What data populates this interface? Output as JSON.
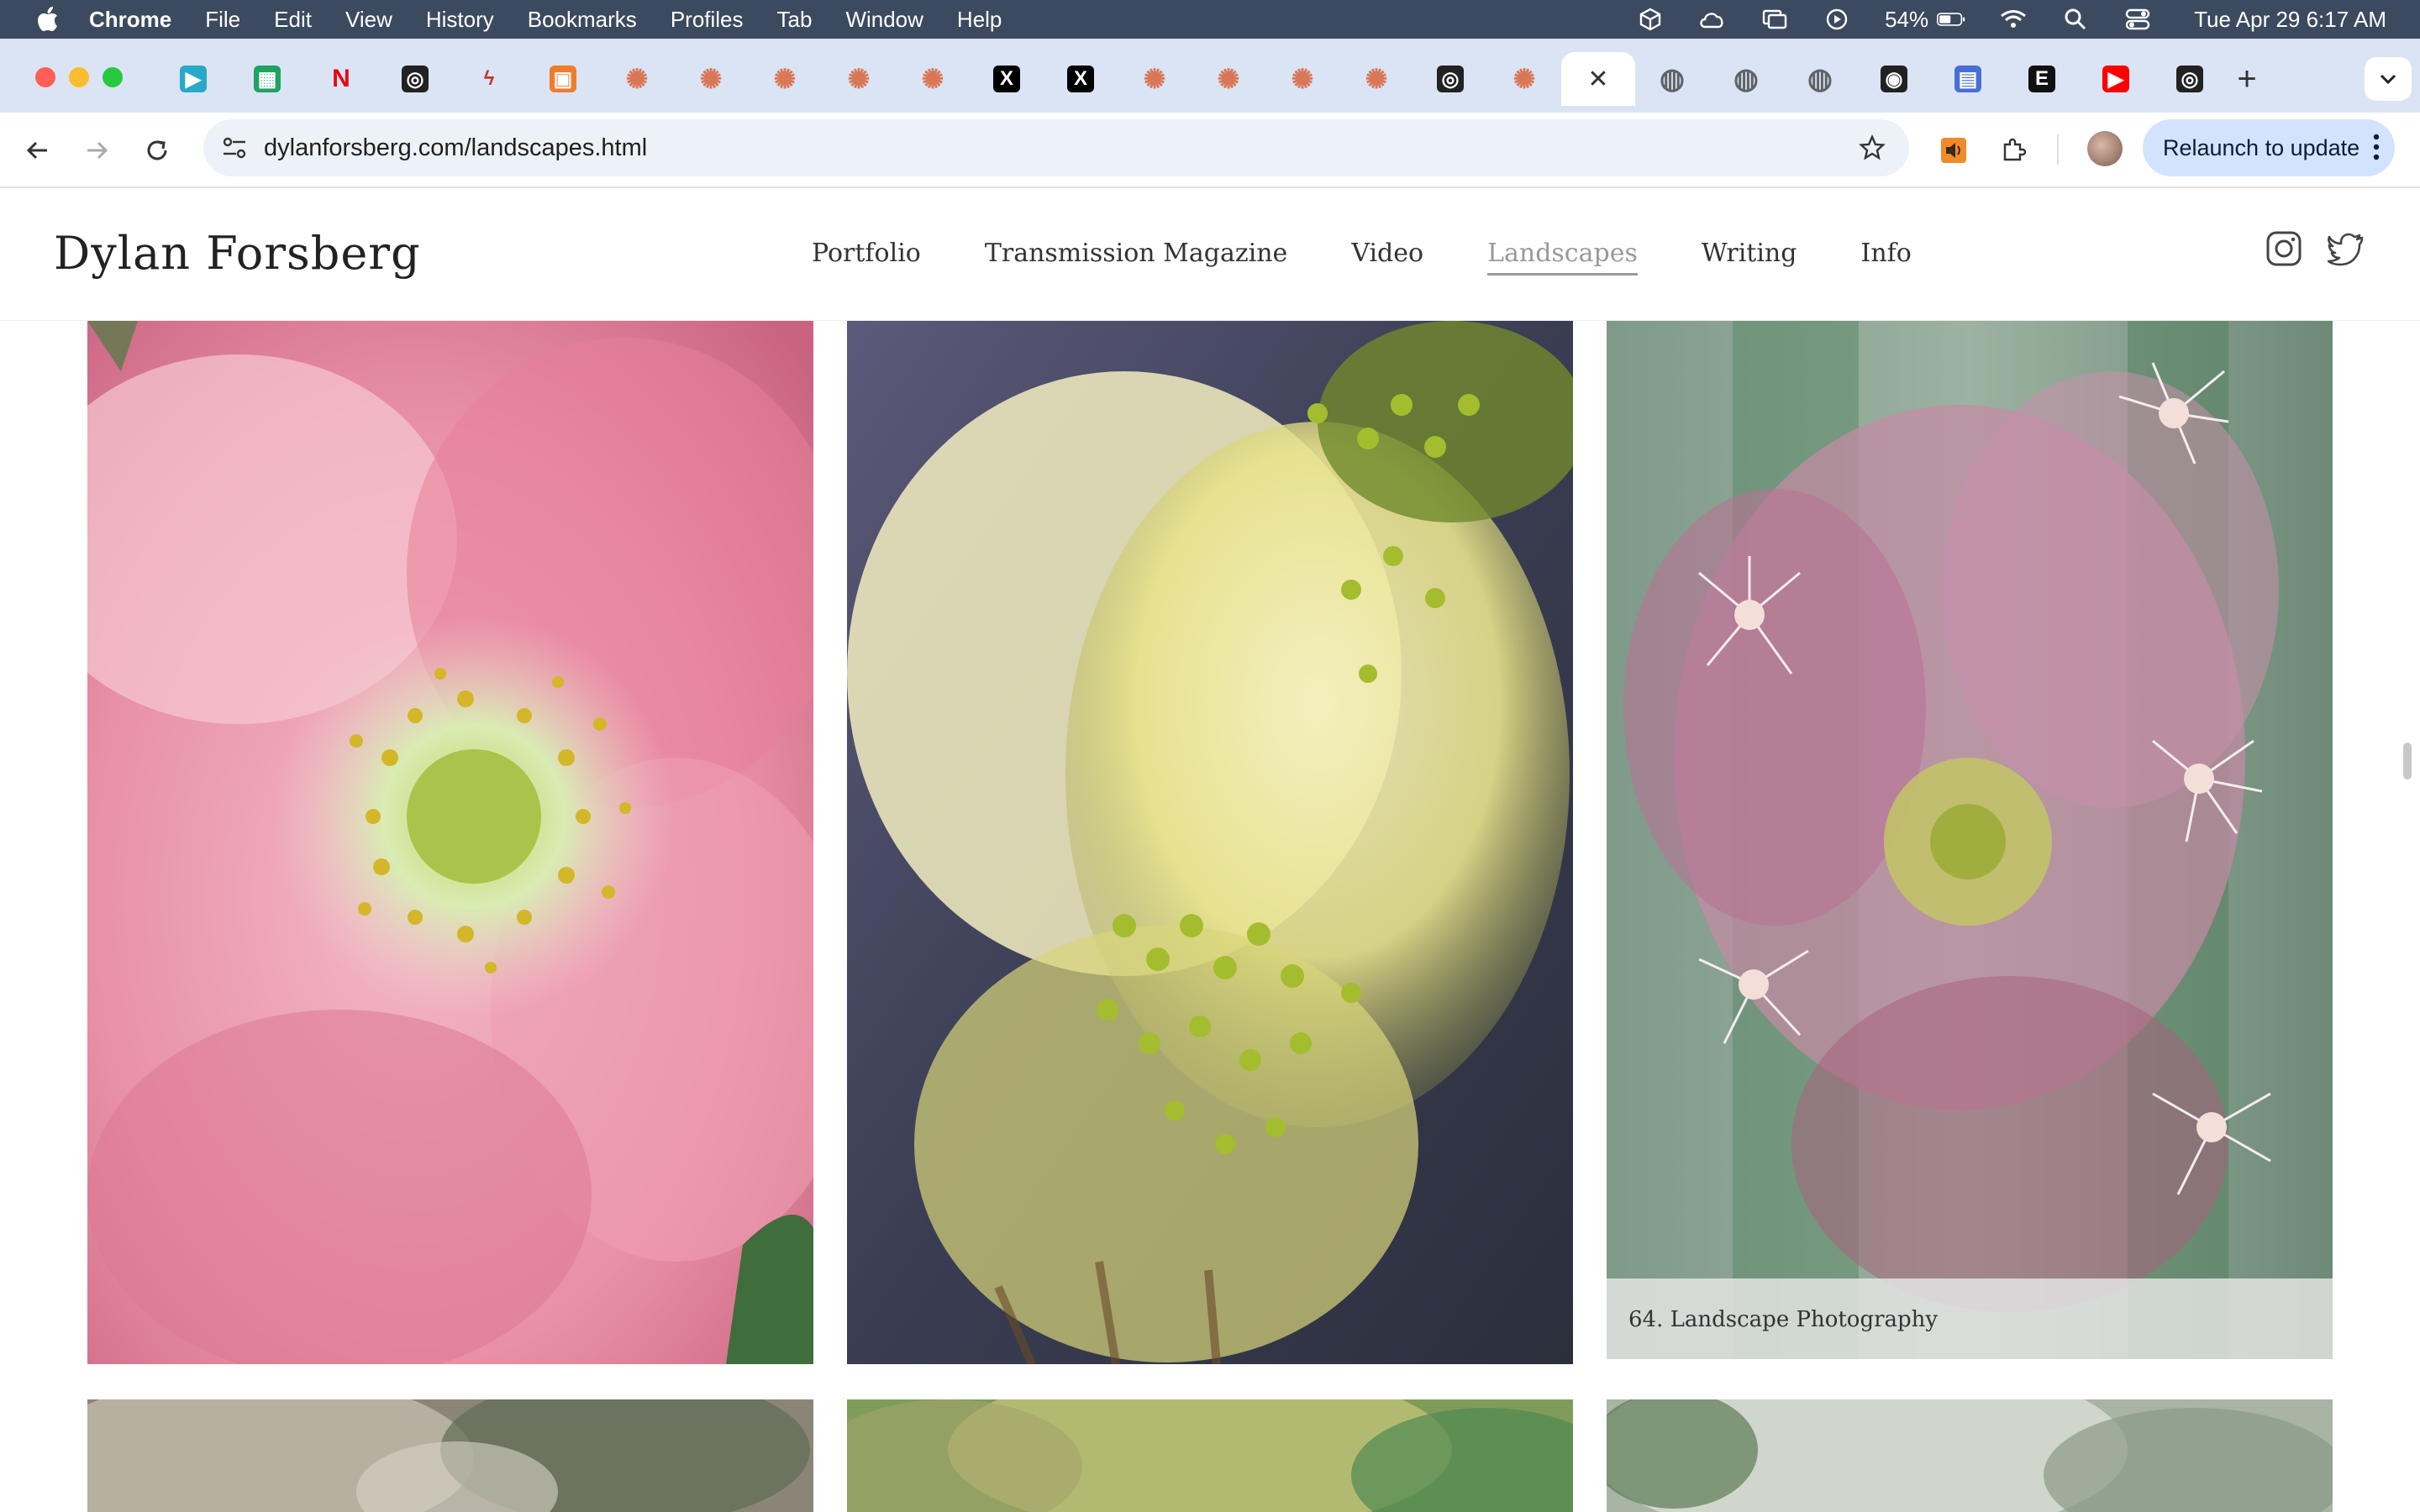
{
  "menubar": {
    "app_name": "Chrome",
    "items": [
      "File",
      "Edit",
      "View",
      "History",
      "Bookmarks",
      "Profiles",
      "Tab",
      "Window",
      "Help"
    ],
    "battery_percent": "54%",
    "clock": "Tue Apr 29  6:17 AM"
  },
  "tabs": [
    {
      "icon": "play-icon",
      "color": "#2aa7c9",
      "glyph": "▶"
    },
    {
      "icon": "sheets-icon",
      "color": "#1ea362",
      "glyph": "▦"
    },
    {
      "icon": "netflix-icon",
      "color": "#e50914",
      "glyph": "N"
    },
    {
      "icon": "openai-icon",
      "color": "#222222",
      "glyph": "◎"
    },
    {
      "icon": "squiggle-icon",
      "color": "#c0392b",
      "glyph": "ϟ"
    },
    {
      "icon": "bookmark-app-icon",
      "color": "#f07c2b",
      "glyph": "▣"
    },
    {
      "icon": "claude-icon",
      "color": "#d97757",
      "glyph": "✺"
    },
    {
      "icon": "claude-icon",
      "color": "#d97757",
      "glyph": "✺"
    },
    {
      "icon": "claude-icon",
      "color": "#d97757",
      "glyph": "✺"
    },
    {
      "icon": "claude-icon",
      "color": "#d97757",
      "glyph": "✺"
    },
    {
      "icon": "claude-icon",
      "color": "#d97757",
      "glyph": "✺"
    },
    {
      "icon": "x-icon",
      "color": "#000000",
      "glyph": "X"
    },
    {
      "icon": "x-icon",
      "color": "#000000",
      "glyph": "X"
    },
    {
      "icon": "claude-icon",
      "color": "#d97757",
      "glyph": "✺"
    },
    {
      "icon": "claude-icon",
      "color": "#d97757",
      "glyph": "✺"
    },
    {
      "icon": "claude-icon",
      "color": "#d97757",
      "glyph": "✺"
    },
    {
      "icon": "claude-icon",
      "color": "#d97757",
      "glyph": "✺"
    },
    {
      "icon": "openai-icon",
      "color": "#222222",
      "glyph": "◎"
    },
    {
      "icon": "claude-icon",
      "color": "#d97757",
      "glyph": "✺"
    },
    {
      "icon": "close-icon",
      "color": "#ffffff",
      "glyph": "✕",
      "active": true
    },
    {
      "icon": "globe-icon",
      "color": "#5f6368",
      "glyph": "◍"
    },
    {
      "icon": "globe-icon",
      "color": "#5f6368",
      "glyph": "◍"
    },
    {
      "icon": "globe-icon",
      "color": "#5f6368",
      "glyph": "◍"
    },
    {
      "icon": "github-icon",
      "color": "#222222",
      "glyph": "◉"
    },
    {
      "icon": "app-grid-icon",
      "color": "#4a6fd4",
      "glyph": "▤"
    },
    {
      "icon": "e-icon",
      "color": "#111111",
      "glyph": "E"
    },
    {
      "icon": "youtube-icon",
      "color": "#ff0000",
      "glyph": "▶"
    },
    {
      "icon": "openai-icon",
      "color": "#222222",
      "glyph": "◎"
    }
  ],
  "toolbar": {
    "url_host": "dylanforsberg.com",
    "url_path": "/landscapes.html",
    "relaunch_label": "Relaunch to update"
  },
  "site": {
    "title": "Dylan Forsberg",
    "nav": [
      "Portfolio",
      "Transmission Magazine",
      "Video",
      "Landscapes",
      "Writing",
      "Info"
    ],
    "active_nav": "Landscapes"
  },
  "gallery": {
    "caption": "64. Landscape Photography"
  }
}
